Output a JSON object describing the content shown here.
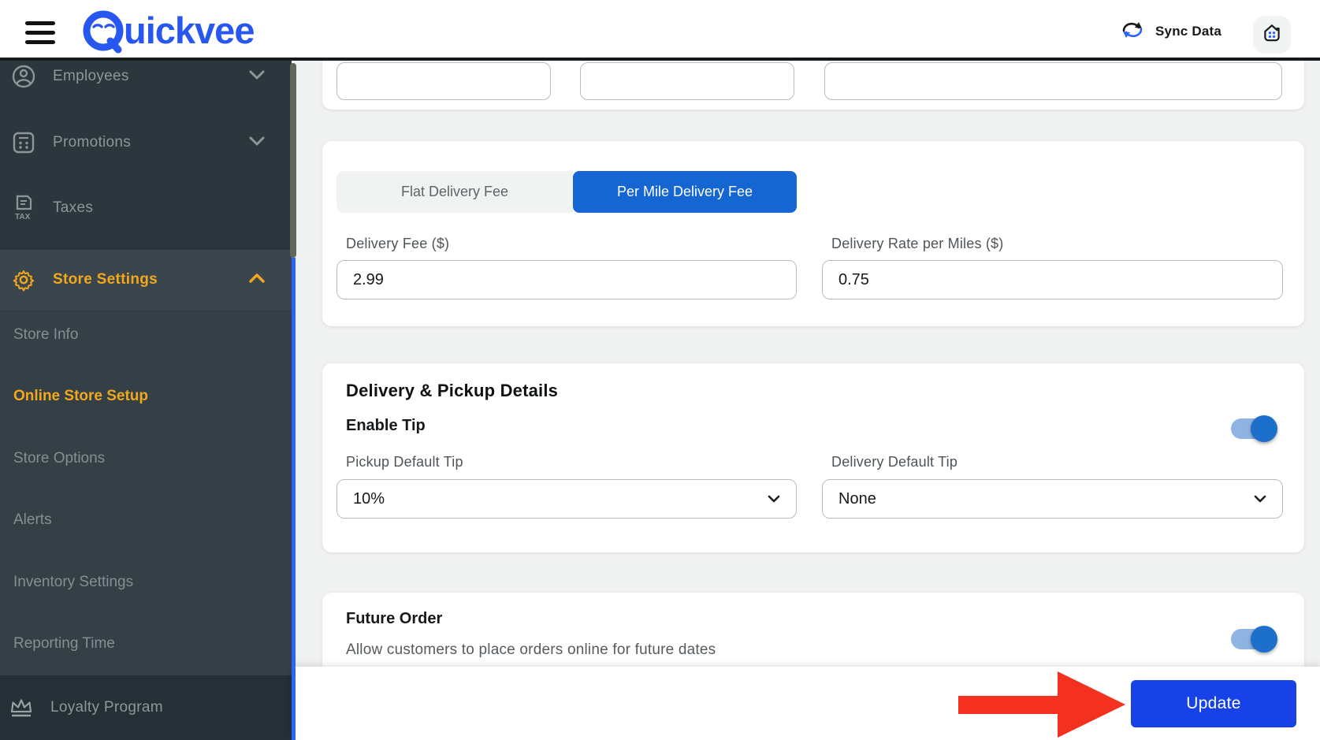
{
  "header": {
    "brand": "Quickvee",
    "sync_label": "Sync Data"
  },
  "sidebar": {
    "items": [
      {
        "label": "Employees"
      },
      {
        "label": "Promotions"
      },
      {
        "label": "Taxes"
      },
      {
        "label": "Store Settings"
      }
    ],
    "submenu": [
      {
        "label": "Store Info"
      },
      {
        "label": "Online Store Setup"
      },
      {
        "label": "Store Options"
      },
      {
        "label": "Alerts"
      },
      {
        "label": "Inventory Settings"
      },
      {
        "label": "Reporting Time"
      }
    ],
    "loyalty": {
      "label": "Loyalty Program"
    }
  },
  "content": {
    "delivery_fee_card": {
      "tabs": [
        {
          "label": "Flat Delivery Fee"
        },
        {
          "label": "Per Mile Delivery Fee"
        }
      ],
      "active_tab": "Per Mile Delivery Fee",
      "fields": [
        {
          "label": "Delivery Fee ($)",
          "value": "2.99"
        },
        {
          "label": "Delivery Rate per Miles ($)",
          "value": "0.75"
        }
      ]
    },
    "delivery_pickup_card": {
      "title": "Delivery & Pickup Details",
      "enable_tip": {
        "label": "Enable Tip",
        "on": "true"
      },
      "pickup_default_tip": {
        "label": "Pickup Default Tip",
        "value": "10%"
      },
      "delivery_default_tip": {
        "label": "Delivery Default Tip",
        "value": "None"
      }
    },
    "future_order_card": {
      "title": "Future Order",
      "subtitle": "Allow customers to place orders online for future dates",
      "on": "true"
    },
    "footer": {
      "update_label": "Update"
    }
  },
  "colors": {
    "tab_active_blue": "#1565D2",
    "update_blue": "#1742E8",
    "brand_blue": "#2857F0",
    "amber": "#F2A81D",
    "arrow_red": "#F4301F",
    "accent_line_blue": "#2A63FF",
    "toggle_track": "#8FB4E3",
    "toggle_knob": "#1C6FCA"
  }
}
